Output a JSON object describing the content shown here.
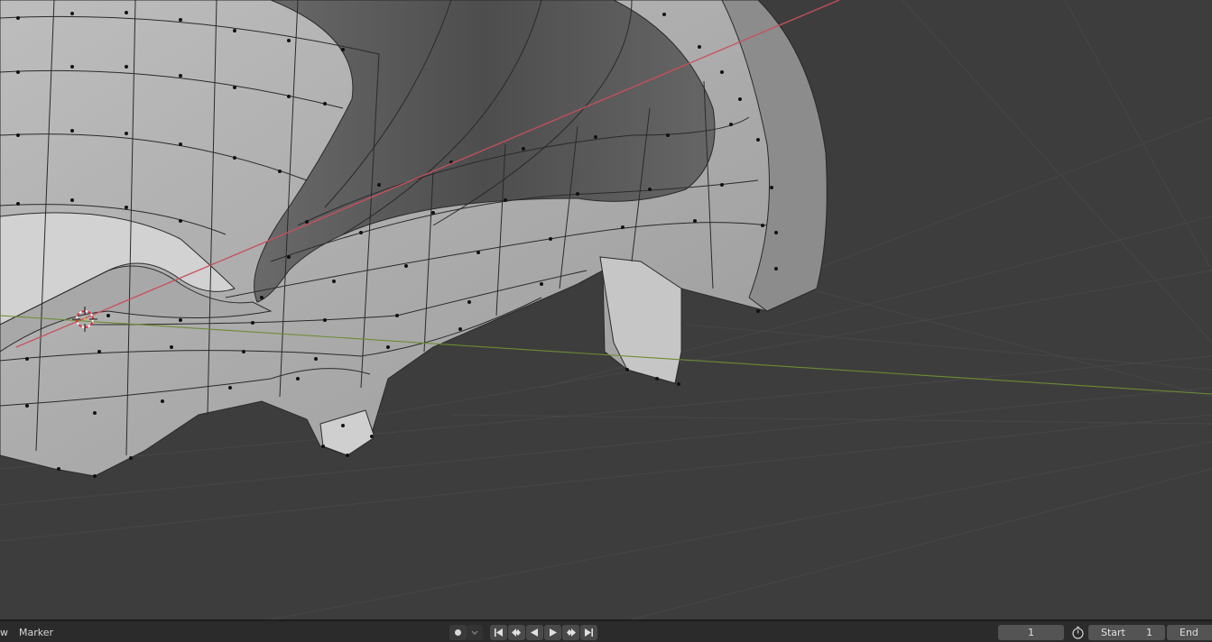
{
  "timeline": {
    "view_label": "w",
    "marker_label": "Marker",
    "current_frame": "1",
    "start_label": "Start",
    "start_value": "1",
    "end_label": "End"
  },
  "icons": {
    "keyframe": "keyframe-dot-icon",
    "dropdown": "chevron-down-icon",
    "jump_start": "jump-to-start-icon",
    "prev_keyframe": "prev-keyframe-icon",
    "play_reverse": "play-reverse-icon",
    "play": "play-icon",
    "next_keyframe": "next-keyframe-icon",
    "jump_end": "jump-to-end-icon",
    "stopwatch": "stopwatch-icon"
  },
  "colors": {
    "viewport_bg": "#3d3d3d",
    "x_axis": "#c8505a",
    "y_axis": "#6c8c32",
    "mesh_face": "#b8b8b8",
    "timeline_bg": "#2b2b2b"
  }
}
